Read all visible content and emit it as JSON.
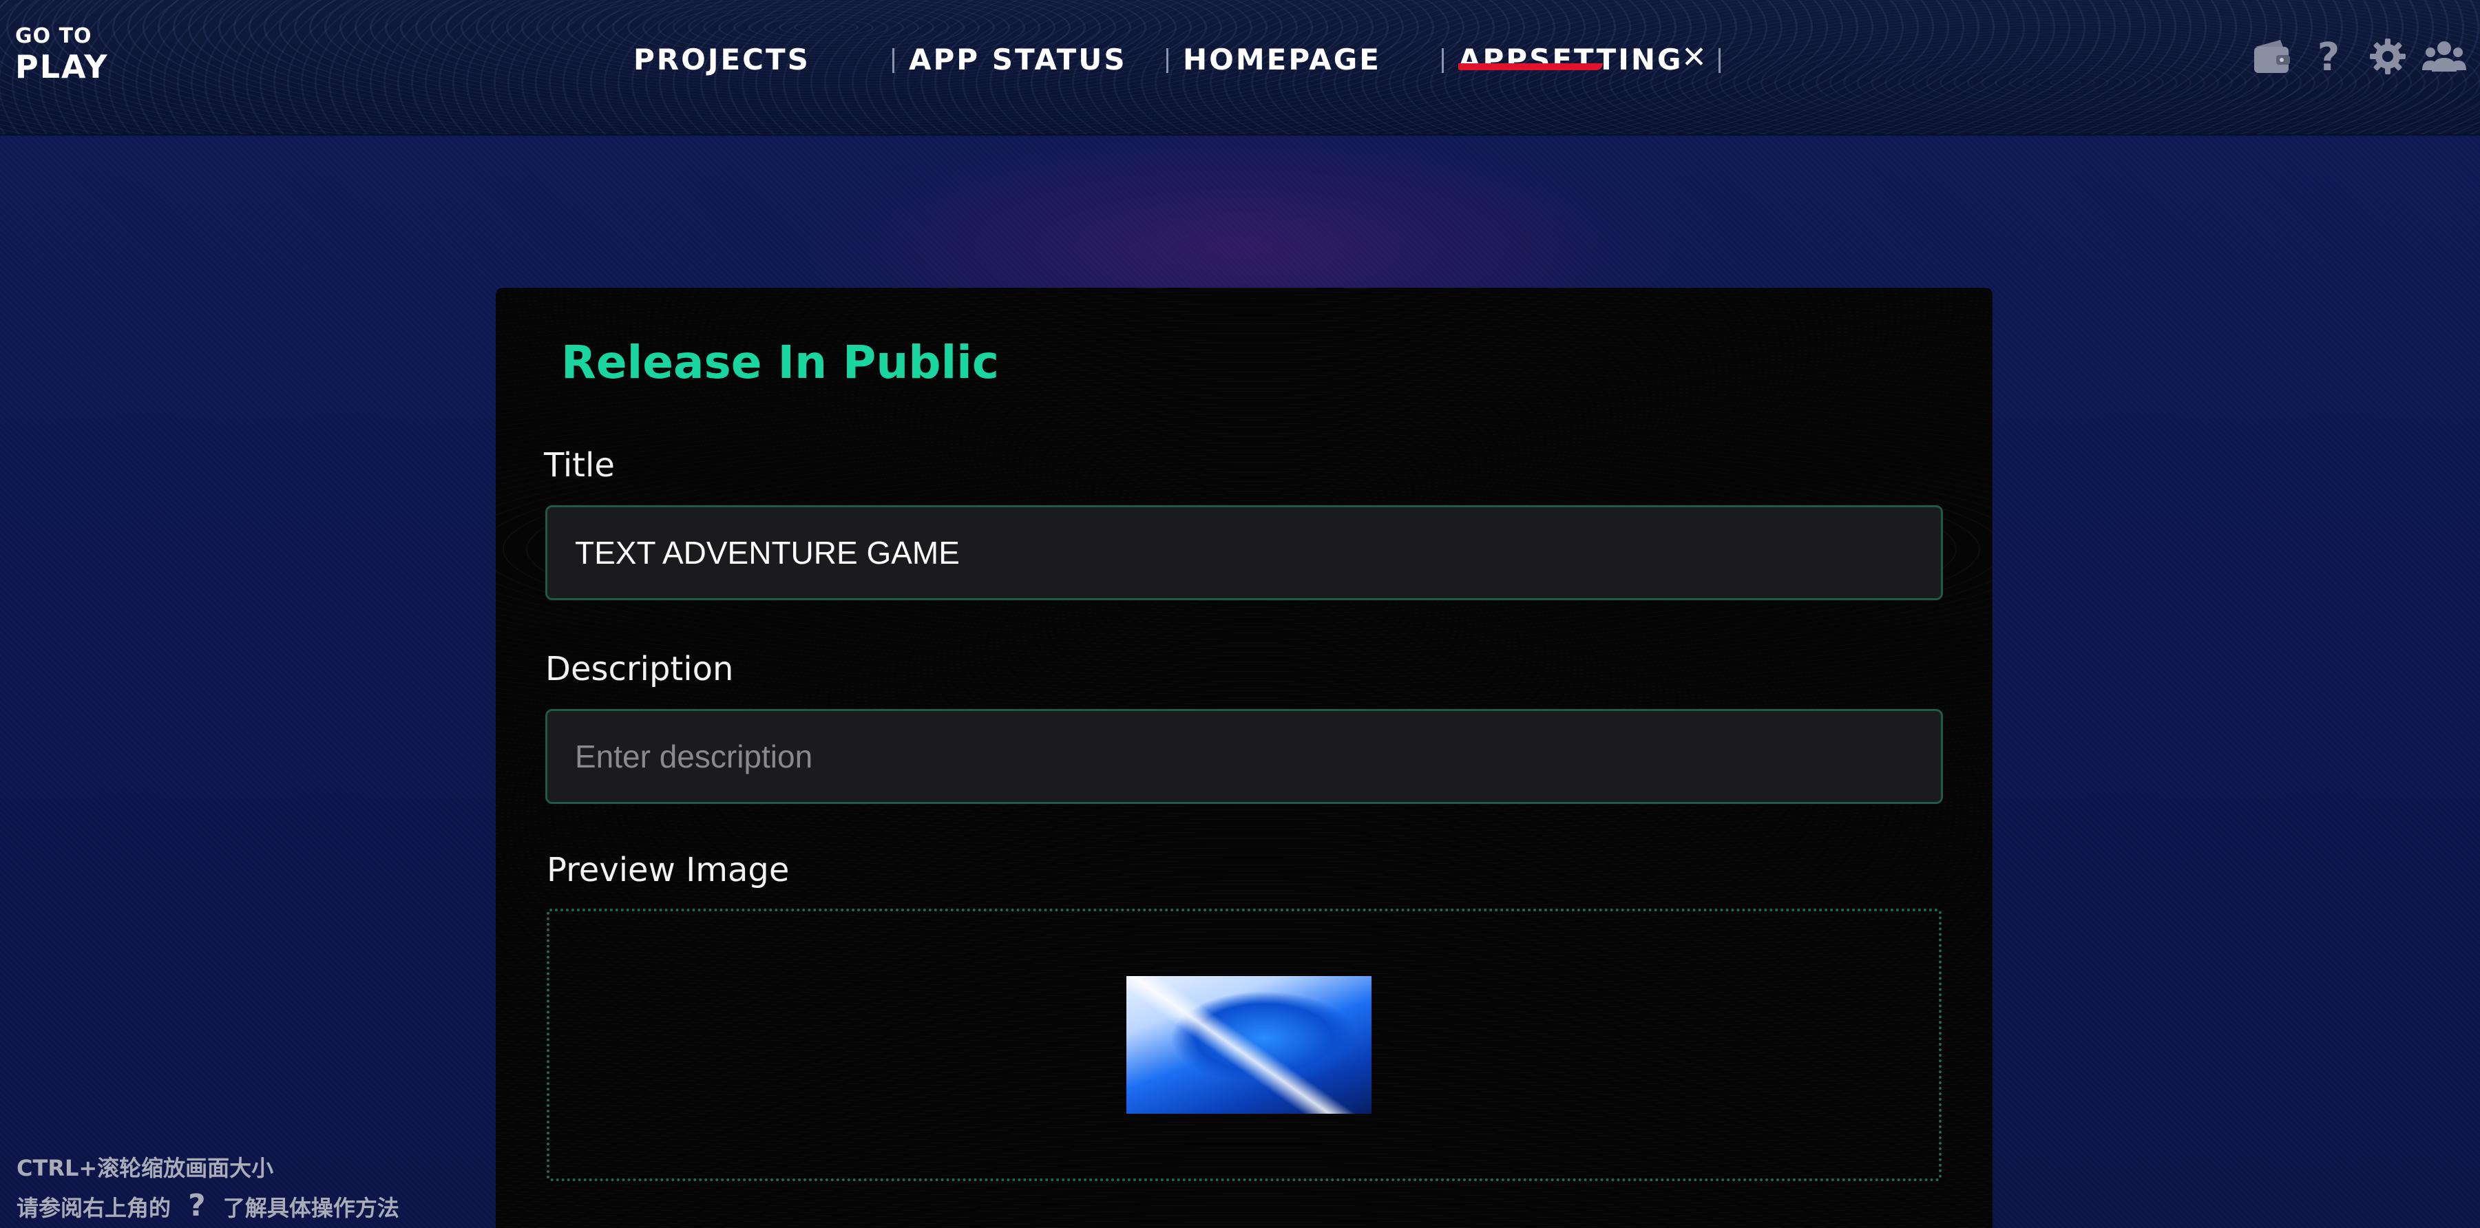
{
  "logo": {
    "line1": "GO TO",
    "line2": "PLAY"
  },
  "nav": {
    "items": [
      {
        "label": "PROJECTS"
      },
      {
        "label": "APP STATUS"
      },
      {
        "label": "HOMEPAGE"
      },
      {
        "label": "APPSETTING",
        "active": true
      }
    ],
    "close_symbol": "✕",
    "active_color": "#e2122a"
  },
  "toolbar_icons": [
    "wallet-icon",
    "help-icon",
    "gear-icon",
    "users-icon"
  ],
  "panel": {
    "title": "Release In Public",
    "title_color": "#19d6a0",
    "title_field": {
      "label": "Title",
      "value": "TEXT ADVENTURE GAME"
    },
    "description_field": {
      "label": "Description",
      "value": "",
      "placeholder": "Enter description"
    },
    "preview_image": {
      "label": "Preview Image"
    }
  },
  "hints": {
    "line1": "CTRL+滚轮缩放画面大小",
    "line2_prefix": "请参阅右上角的",
    "line2_icon": "?",
    "line2_suffix": "了解具体操作方法"
  }
}
